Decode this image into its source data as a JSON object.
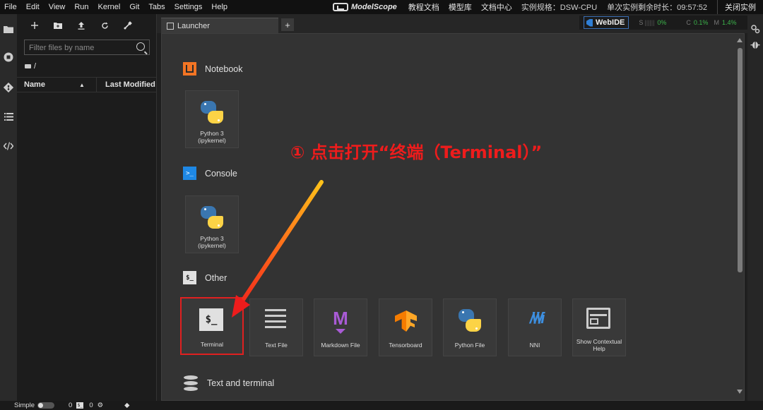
{
  "menubar": {
    "items": [
      "File",
      "Edit",
      "View",
      "Run",
      "Kernel",
      "Git",
      "Tabs",
      "Settings",
      "Help"
    ],
    "brand": "ModelScope",
    "links": [
      "教程文档",
      "模型库",
      "文档中心"
    ],
    "spec": "实例规格：DSW-CPU",
    "remaining": "单次实例剩余时长：09:57:52",
    "close_label": "关闭实例"
  },
  "filebrowser": {
    "search_placeholder": "Filter files by name",
    "path": "/",
    "col_name": "Name",
    "col_modified": "Last Modified"
  },
  "tabbar": {
    "tab_label": "Launcher",
    "webide_label": "WebIDE",
    "meter_s": {
      "label": "S",
      "value": "0%"
    },
    "meter_c": {
      "label": "C",
      "value": "0.1%"
    },
    "meter_m": {
      "label": "M",
      "value": "1.4%"
    }
  },
  "launcher": {
    "sections": {
      "notebook": "Notebook",
      "console": "Console",
      "other": "Other",
      "text_terminal": "Text and terminal"
    },
    "notebook_cards": [
      {
        "label": "Python 3 (ipykernel)"
      }
    ],
    "console_cards": [
      {
        "label": "Python 3 (ipykernel)"
      }
    ],
    "other_cards": [
      {
        "label": "Terminal",
        "icon": "terminal-icon"
      },
      {
        "label": "Text File",
        "icon": "text-file-icon"
      },
      {
        "label": "Markdown File",
        "icon": "markdown-icon"
      },
      {
        "label": "Tensorboard",
        "icon": "tensorboard-icon"
      },
      {
        "label": "Python File",
        "icon": "python-icon"
      },
      {
        "label": "NNI",
        "icon": "nni-icon"
      },
      {
        "label": "Show Contextual Help",
        "icon": "contextual-help-icon"
      }
    ]
  },
  "annotation": {
    "text": "① 点击打开“终端（Terminal）”",
    "color": "#ee1c1c"
  },
  "statusbar": {
    "simple_label": "Simple",
    "count_a": "0",
    "count_b": "0"
  },
  "colors": {
    "accent_red": "#e02020",
    "notebook_orange": "#f37524",
    "console_blue": "#1e88e5",
    "python_blue": "#3a76b0",
    "python_yellow": "#fcd346"
  }
}
